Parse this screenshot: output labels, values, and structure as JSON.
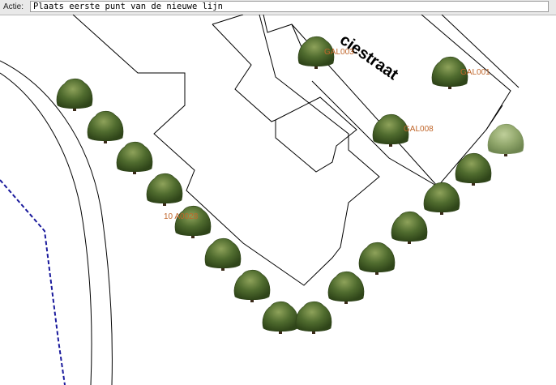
{
  "action_bar": {
    "label": "Actie:",
    "value": "Plaats eerste punt van de nieuwe lijn"
  },
  "map": {
    "street_name": "ciestraat",
    "object_labels": [
      {
        "id": "gal003",
        "text": "GAL003"
      },
      {
        "id": "gal001",
        "text": "GAL001"
      },
      {
        "id": "gal008",
        "text": "GAL008"
      },
      {
        "id": "a0028",
        "text": "10 A0028"
      }
    ],
    "line_color": "#000000",
    "boundary_color": "#1a1a9c",
    "label_color": "#c0662a",
    "tree_color": "#4f6b2e"
  }
}
